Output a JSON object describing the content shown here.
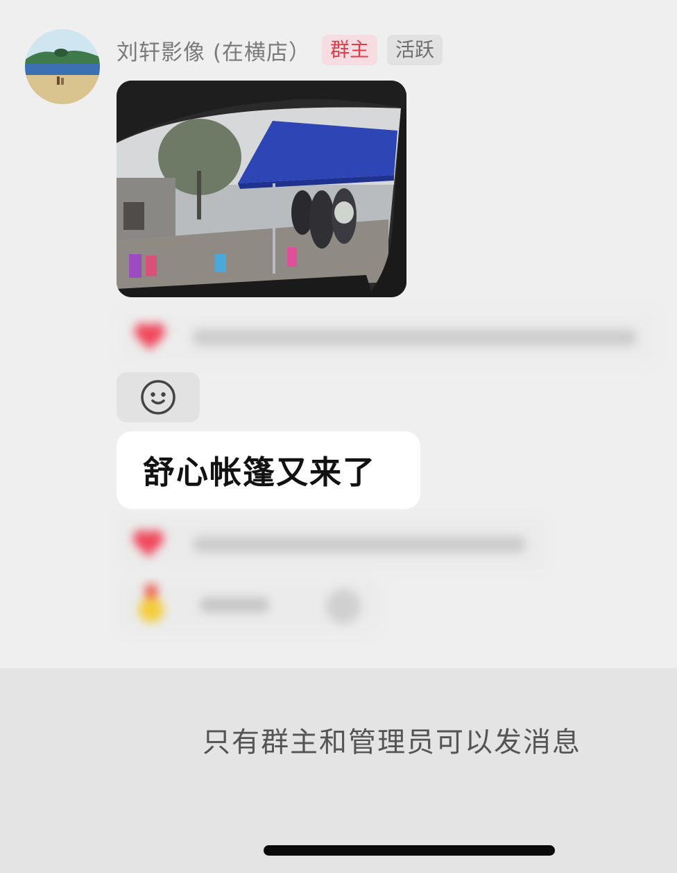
{
  "message": {
    "sender_name": "刘轩影像 (在横店）",
    "badges": {
      "owner": "群主",
      "active": "活跃"
    },
    "photo_icon": "photo-rainy-tent",
    "text": "舒心帐篷又来了"
  },
  "reactions": {
    "heart_icon": "heart-icon",
    "add_reaction_icon": "smiley-icon"
  },
  "composer": {
    "notice": "只有群主和管理员可以发消息"
  },
  "colors": {
    "background": "#efefef",
    "owner_badge_text": "#e23b4c",
    "owner_badge_bg": "#f6dde1"
  }
}
